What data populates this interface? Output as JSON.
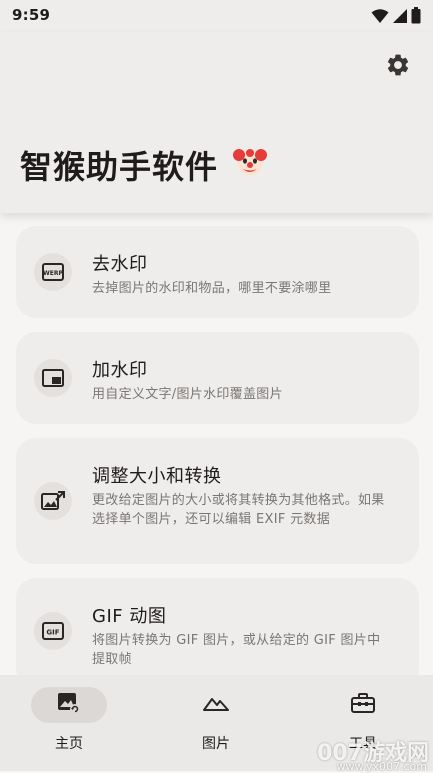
{
  "status_bar": {
    "time": "9:59",
    "icons": [
      "wifi-icon",
      "signal-icon",
      "battery-icon"
    ]
  },
  "app_bar": {
    "title": "智猴助手软件",
    "emoji": "🤡",
    "settings_icon": "gear-icon"
  },
  "features": [
    {
      "icon": "remove-watermark-icon",
      "title": "去水印",
      "description": "去掉图片的水印和物品，哪里不要涂哪里"
    },
    {
      "icon": "add-watermark-icon",
      "title": "加水印",
      "description": "用自定义文字/图片水印覆盖图片"
    },
    {
      "icon": "resize-convert-icon",
      "title": "调整大小和转换",
      "description": "更改给定图片的大小或将其转换为其他格式。如果选择单个图片，还可以编辑 EXIF 元数据"
    },
    {
      "icon": "gif-icon",
      "title": "GIF 动图",
      "description": "将图片转换为 GIF 图片，或从给定的 GIF 图片中提取帧"
    }
  ],
  "bottom_nav": {
    "items": [
      {
        "label": "主页",
        "icon": "home-image-icon",
        "active": true
      },
      {
        "label": "图片",
        "icon": "mountain-icon",
        "active": false
      },
      {
        "label": "工具",
        "icon": "toolbox-icon",
        "active": false
      }
    ]
  },
  "watermark": {
    "text": "007游戏网",
    "url": "www.yx007.com"
  },
  "colors": {
    "background": "#f7f5f3",
    "surface": "#efedeb",
    "icon_bg": "#e3e0de",
    "text_primary": "#1f1c1b",
    "text_secondary": "#7a7674",
    "nav_active": "#dcd8d6"
  }
}
